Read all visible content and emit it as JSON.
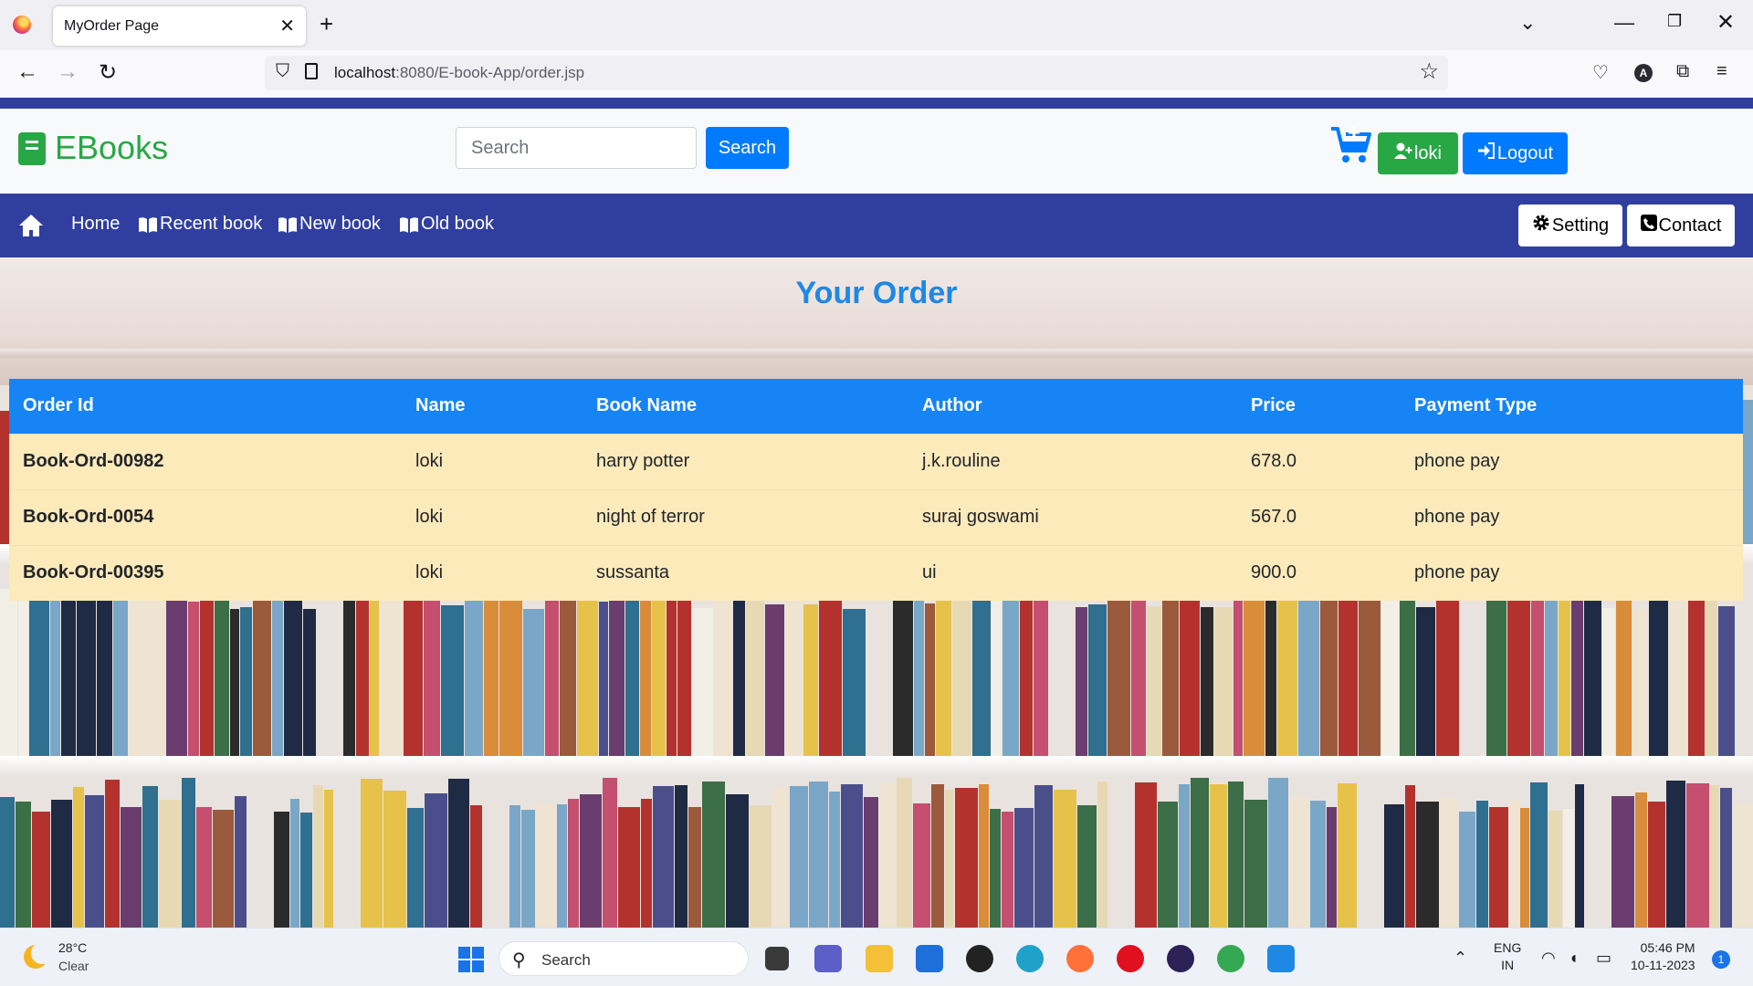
{
  "browser": {
    "tab_title": "MyOrder Page",
    "url_host": "localhost",
    "url_rest": ":8080/E-book-App/order.jsp",
    "account_initial": "A"
  },
  "header": {
    "logo_text": "EBooks",
    "search_placeholder": "Search",
    "search_button": "Search",
    "user_button": "loki",
    "logout_button": "Logout",
    "colors": {
      "brand_green": "#28a745",
      "primary_blue": "#007bff",
      "nav_indigo": "#303f9f"
    }
  },
  "nav": {
    "items": [
      "Home",
      "Recent book",
      "New book",
      "Old book"
    ],
    "setting": "Setting",
    "contact": "Contact"
  },
  "main": {
    "title": "Your Order",
    "table": {
      "headers": [
        "Order Id",
        "Name",
        "Book Name",
        "Author",
        "Price",
        "Payment Type"
      ],
      "rows": [
        [
          "Book-Ord-00982",
          "loki",
          "harry potter",
          "j.k.rouline",
          "678.0",
          "phone pay"
        ],
        [
          "Book-Ord-0054",
          "loki",
          "night of terror",
          "suraj goswami",
          "567.0",
          "phone pay"
        ],
        [
          "Book-Ord-00395",
          "loki",
          "sussanta",
          "ui",
          "900.0",
          "phone pay"
        ]
      ]
    }
  },
  "taskbar": {
    "temp": "28°C",
    "condition": "Clear",
    "search_text": "Search",
    "lang_top": "ENG",
    "lang_bottom": "IN",
    "time": "05:46 PM",
    "date": "10-11-2023",
    "notifications": "1"
  }
}
